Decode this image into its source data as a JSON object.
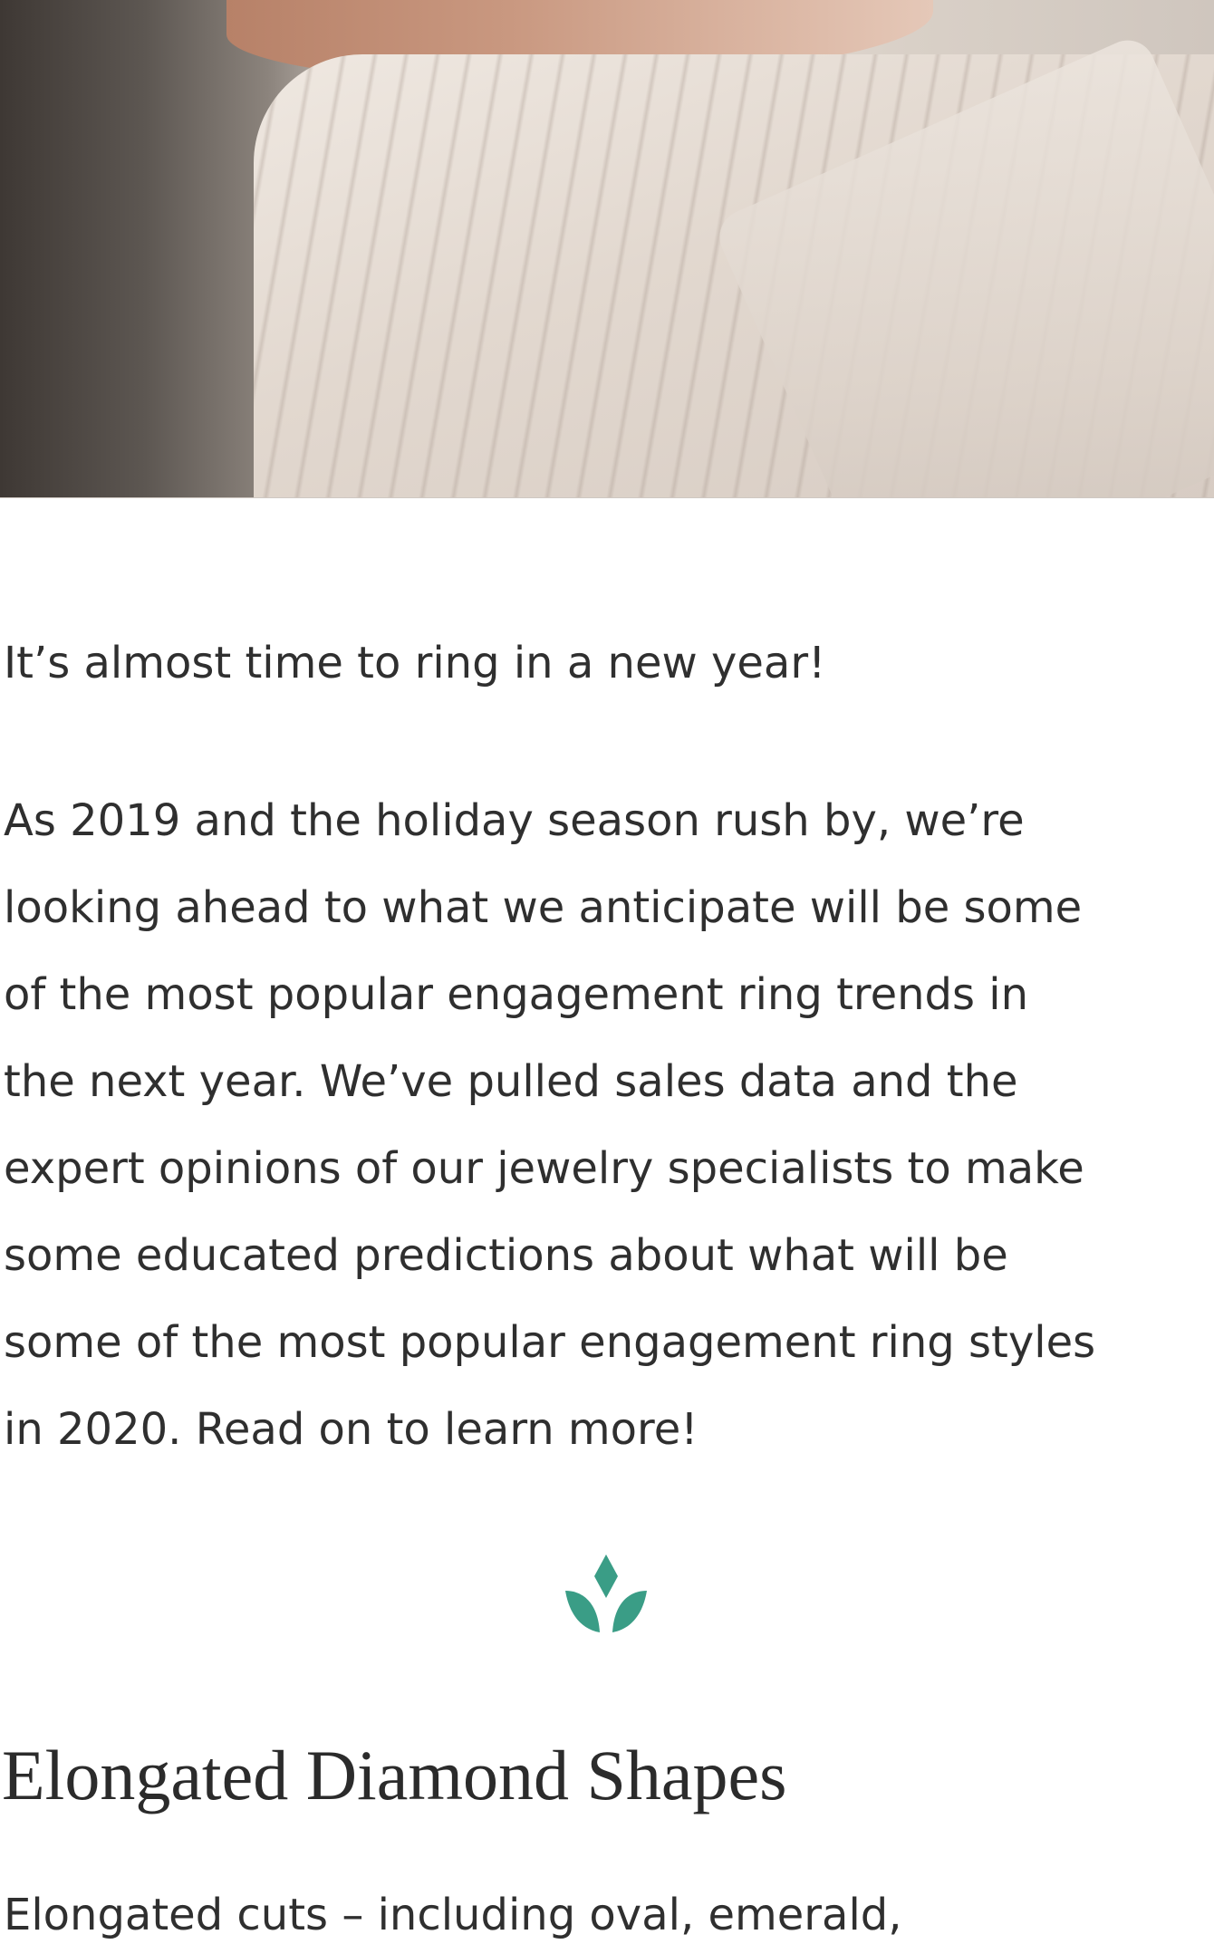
{
  "hero": {
    "image_description": "Close-up of a hand resting on a cream cable-knit sweater"
  },
  "article": {
    "lead": "It’s almost time to ring in a new year!",
    "body_lines": [
      "As 2019 and the holiday season rush by, we’re",
      "looking ahead to what we anticipate will be some",
      "of the most popular engagement ring trends in",
      "the next year. We’ve pulled sales data and the",
      "expert opinions of our jewelry specialists to make",
      "some educated predictions about what will be",
      "some of the most popular engagement ring styles",
      "in 2020. Read on to learn more!"
    ],
    "divider_icon": "diamond-leaf-icon",
    "section": {
      "title": "Elongated Diamond Shapes",
      "intro": "Elongated cuts – including oval, emerald,"
    }
  },
  "colors": {
    "accent": "#3a9d86",
    "text": "#2f2f2f",
    "background": "#ffffff"
  }
}
